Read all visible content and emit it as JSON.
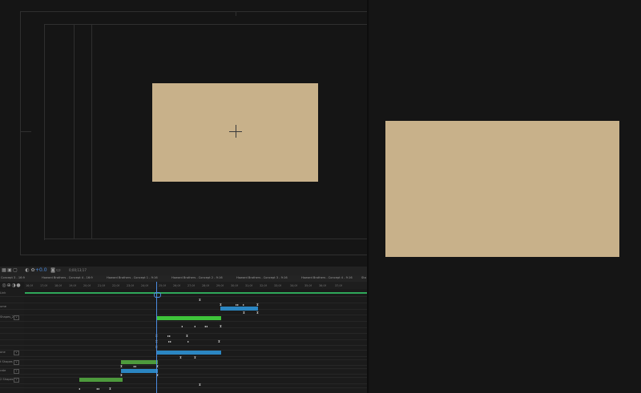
{
  "composition": {
    "frame_color": "#c8b18a",
    "background_color": "#151515"
  },
  "preview": {
    "frame_color": "#c8b18a"
  },
  "toolbar": {
    "timecode": "0;00;13;17",
    "zoom": "+0.0"
  },
  "tabs": [
    "Concept 3 - 16:9",
    "Howard Brothers - Concept 4 - 16:9",
    "Howard Brothers - Concept 1 - 9:16",
    "Howard Brothers - Concept 2 - 9:16",
    "Howard Brothers - Concept 3 - 9:16",
    "Howard Brothers - Concept 4 - 9:16",
    "Sto"
  ],
  "ruler_ticks": [
    "16;0f",
    "17;0f",
    "18;0f",
    "19;0f",
    "20;0f",
    "21;0f",
    "22;0f",
    "23;0f",
    "24;0f",
    "25;0f",
    "26;0f",
    "27;0f",
    "28;0f",
    "29;0f",
    "30;0f",
    "31;0f",
    "32;0f",
    "33;0f",
    "34;0f",
    "35;0f",
    "36;0f",
    "37;0f"
  ],
  "layers": [
    {
      "label": "Link"
    },
    {
      "label": ""
    },
    {
      "label": "ume"
    },
    {
      "label": ""
    },
    {
      "label": "Shapes_2"
    },
    {
      "label": ""
    },
    {
      "label": ""
    },
    {
      "label": ""
    },
    {
      "label": ""
    },
    {
      "label": ""
    },
    {
      "label": "one"
    },
    {
      "label": ""
    },
    {
      "label": "t Shapes"
    },
    {
      "label": ""
    },
    {
      "label": "rate"
    },
    {
      "label": ""
    },
    {
      "label": "2 Shapes"
    }
  ],
  "colors": {
    "green_bar": "#3ec43a",
    "teal_bar": "#2b86c2",
    "playhead": "#4b8be0"
  }
}
